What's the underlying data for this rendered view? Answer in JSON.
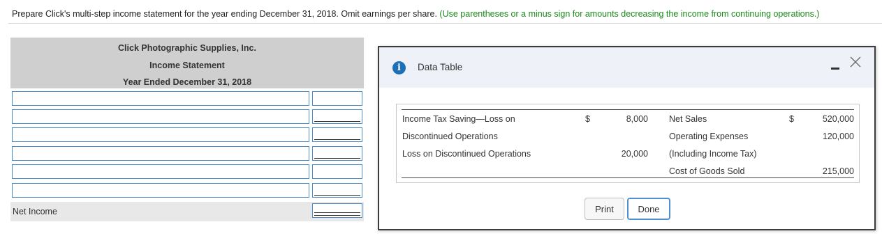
{
  "instruction": {
    "text": "Prepare Click's multi-step income statement for the year ending December 31, 2018. Omit earnings per share.",
    "hint": "(Use parentheses or a minus sign for amounts decreasing the income from continuing operations.)"
  },
  "statement": {
    "company": "Click Photographic Supplies, Inc.",
    "title": "Income Statement",
    "period": "Year Ended December 31, 2018",
    "net_income_label": "Net Income"
  },
  "dialog": {
    "title": "Data Table",
    "print_label": "Print",
    "done_label": "Done",
    "rows": [
      {
        "left_label": "Income Tax Saving—Loss on",
        "left_currency": "$",
        "left_amount": "8,000",
        "right_label": "Net Sales",
        "right_currency": "$",
        "right_amount": "520,000"
      },
      {
        "left_label": "Discontinued Operations",
        "left_currency": "",
        "left_amount": "",
        "right_label": "Operating Expenses",
        "right_currency": "",
        "right_amount": "120,000"
      },
      {
        "left_label": "Loss on Discontinued Operations",
        "left_currency": "",
        "left_amount": "20,000",
        "right_label": "(Including Income Tax)",
        "right_currency": "",
        "right_amount": ""
      },
      {
        "left_label": "",
        "left_currency": "",
        "left_amount": "",
        "right_label": "Cost of Goods Sold",
        "right_currency": "",
        "right_amount": "215,000"
      }
    ]
  },
  "colors": {
    "hint": "#1b8a1b",
    "input_border": "#4a8ec9",
    "header_bg": "#cfcfcf",
    "info_icon": "#1d6fb8"
  },
  "icons": {
    "info": "info-icon",
    "minimize": "minimize-icon",
    "close": "close-icon"
  }
}
